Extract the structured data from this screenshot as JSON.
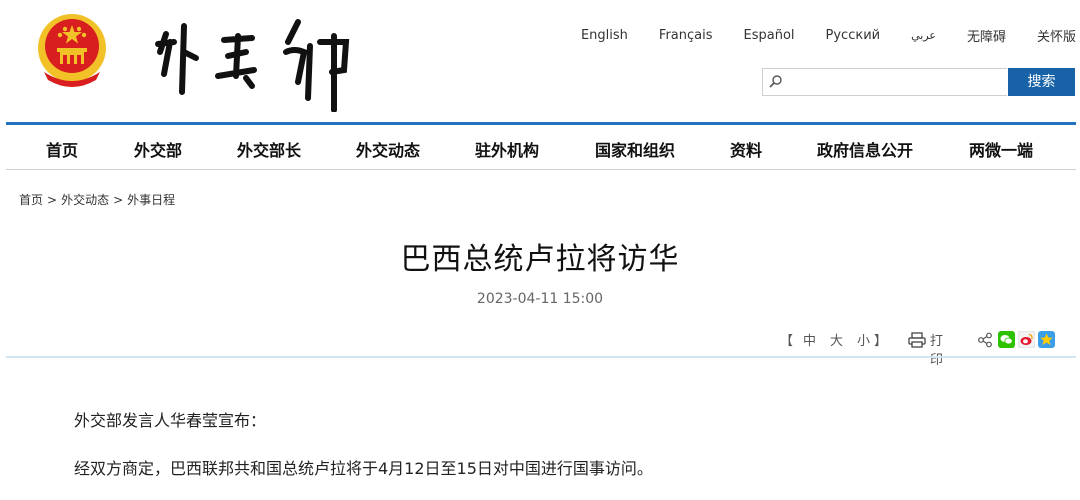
{
  "header": {
    "site_name": "外交部",
    "languages": [
      "English",
      "Français",
      "Español",
      "Русский",
      "عربي",
      "无障碍",
      "关怀版"
    ]
  },
  "search": {
    "placeholder": "",
    "button_label": "搜索"
  },
  "nav": {
    "items": [
      "首页",
      "外交部",
      "外交部长",
      "外交动态",
      "驻外机构",
      "国家和组织",
      "资料",
      "政府信息公开",
      "两微一端"
    ]
  },
  "breadcrumb": {
    "items": [
      "首页",
      "外交动态",
      "外事日程"
    ],
    "separator": ">"
  },
  "article": {
    "title": "巴西总统卢拉将访华",
    "date": "2023-04-11 15:00",
    "paragraphs": [
      "外交部发言人华春莹宣布：",
      "经双方商定，巴西联邦共和国总统卢拉将于4月12日至15日对中国进行国事访问。"
    ]
  },
  "tools": {
    "bracket_open": "【",
    "size_medium": "中",
    "size_large": "大",
    "size_small": "小",
    "bracket_close": "】",
    "print_label": "打印"
  },
  "colors": {
    "accent": "#1862a8",
    "nav_line": "#2373be",
    "emblem_red": "#d81e1e",
    "emblem_gold": "#f2c128"
  },
  "icons": [
    "national-emblem",
    "search-icon",
    "printer-icon",
    "share-icon",
    "wechat-icon",
    "weibo-icon",
    "qzone-icon"
  ]
}
